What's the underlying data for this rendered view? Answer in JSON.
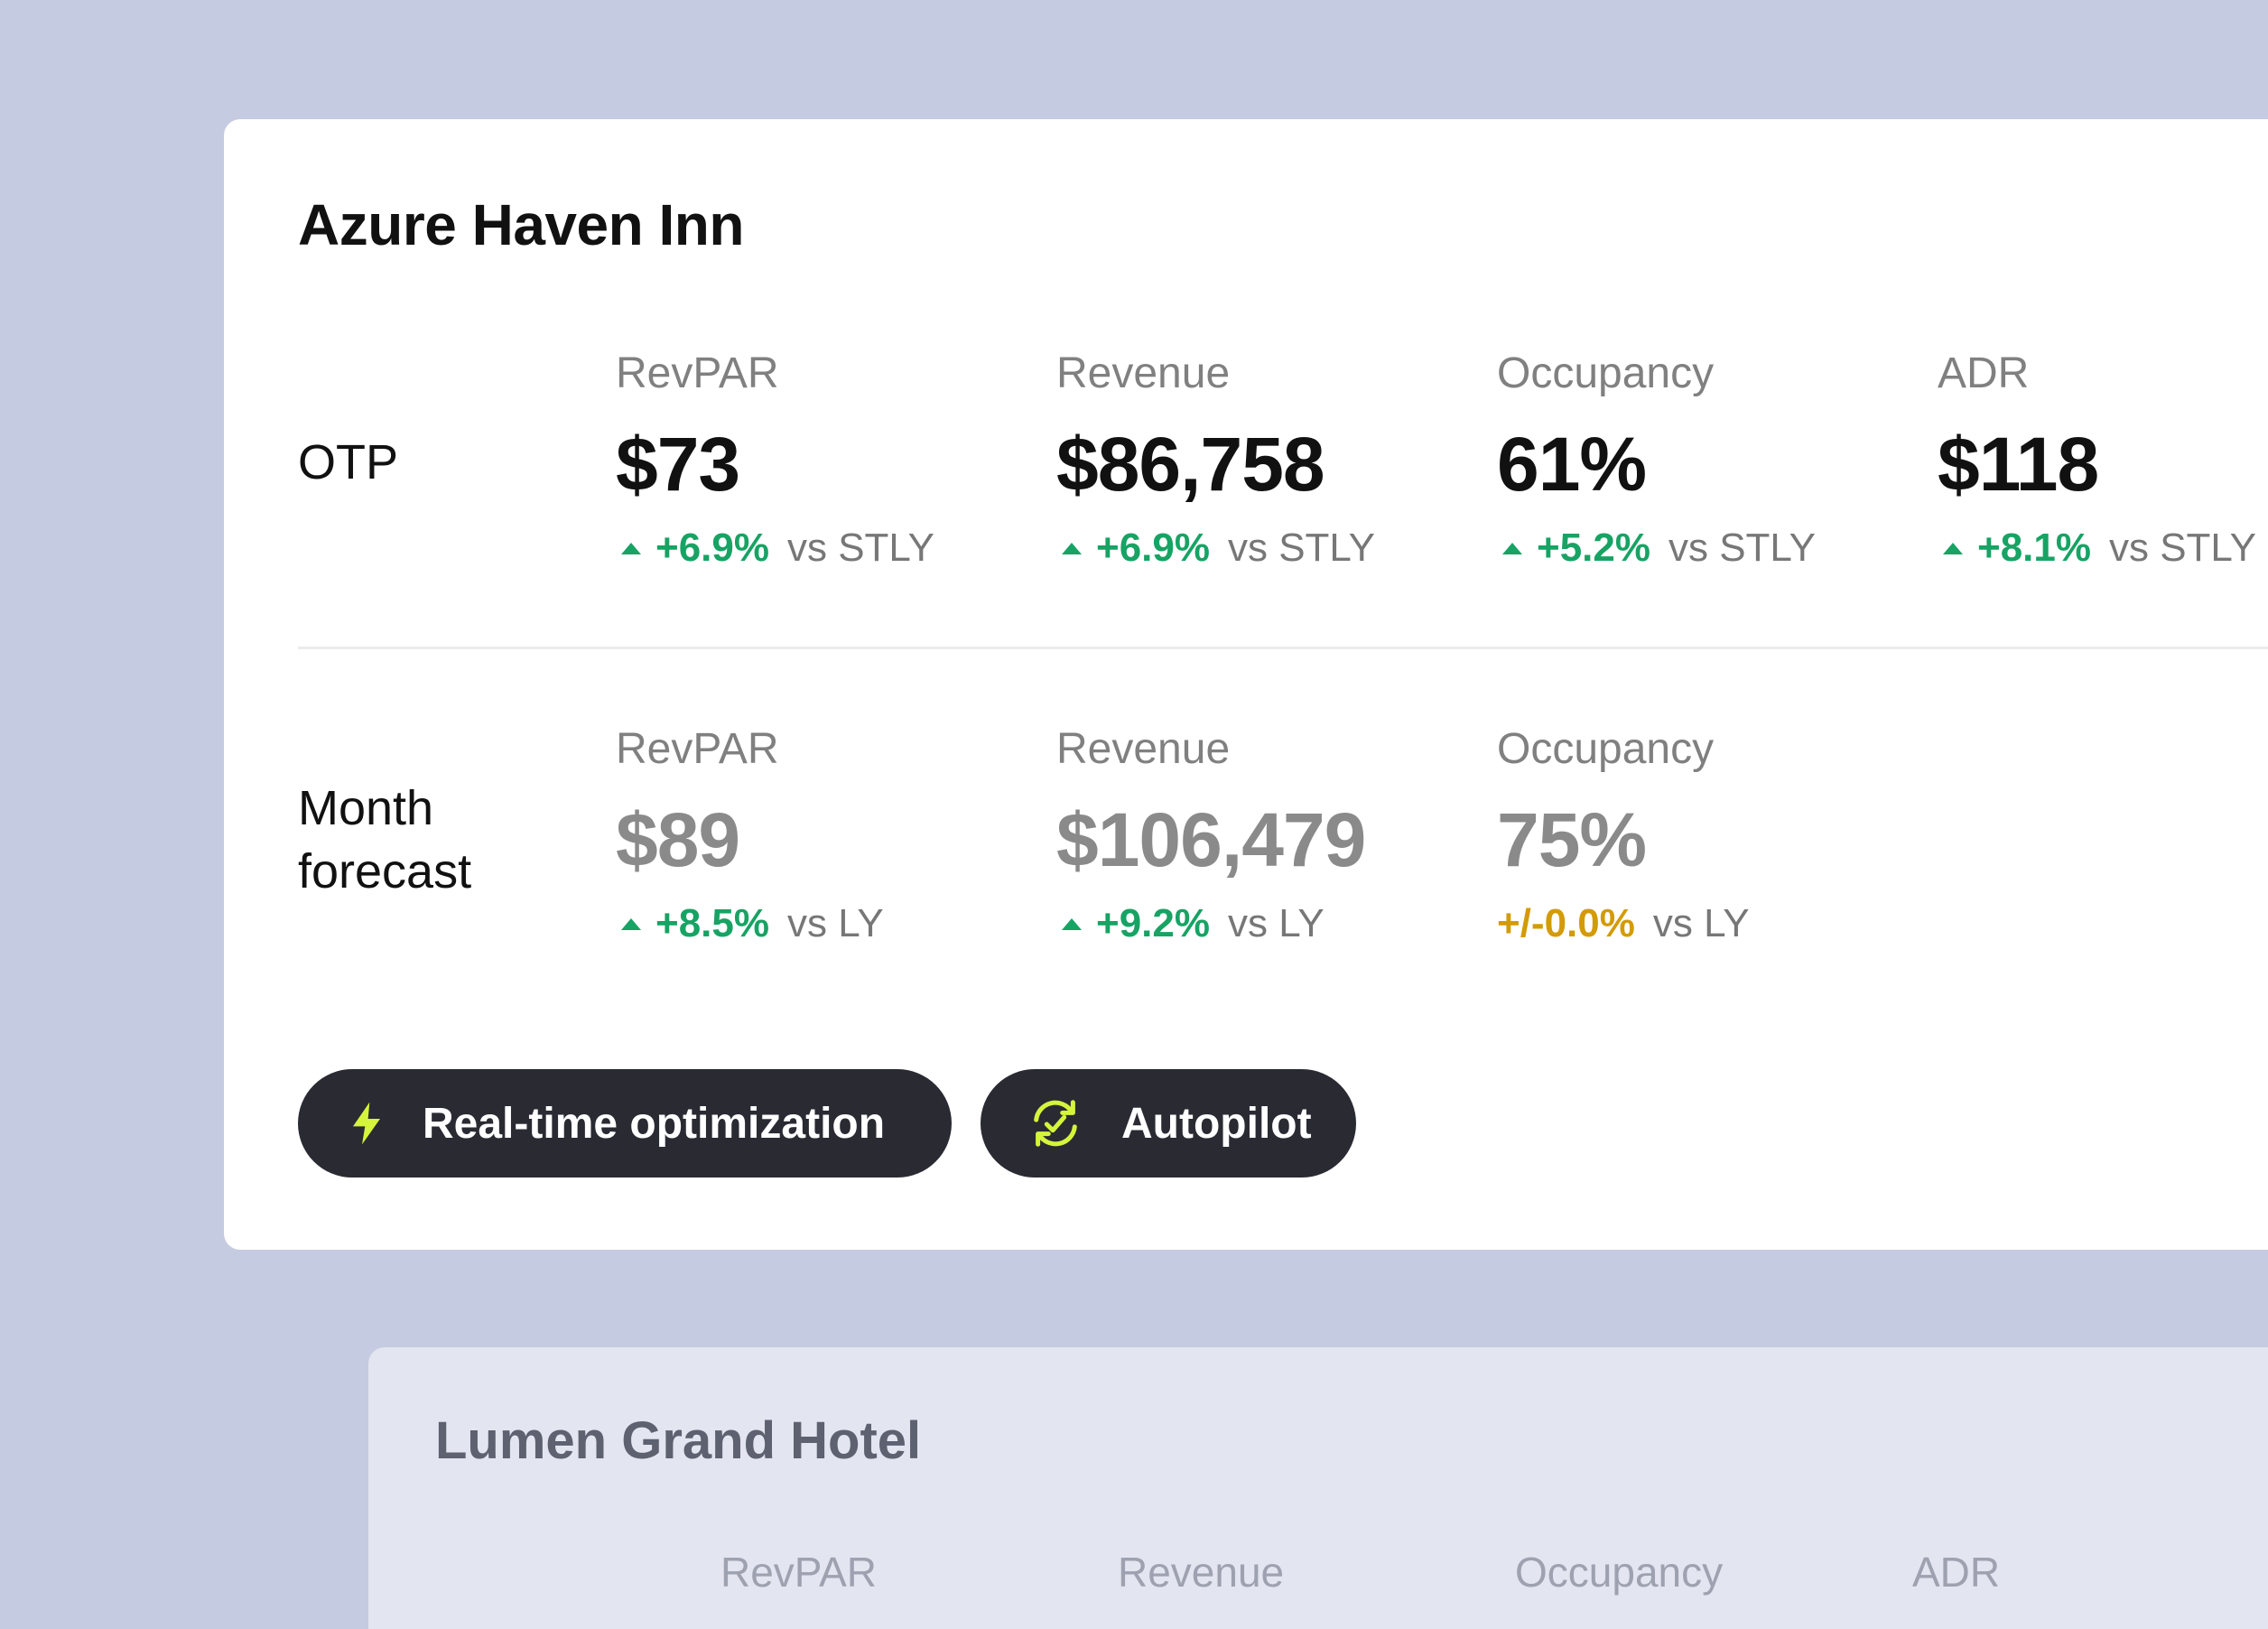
{
  "primary_card": {
    "hotel_name": "Azure Haven Inn",
    "otp": {
      "row_label": "OTP",
      "metrics": [
        {
          "label": "RevPAR",
          "value": "$73",
          "change": "+6.9%",
          "comparison": "vs STLY",
          "trend": "up"
        },
        {
          "label": "Revenue",
          "value": "$86,758",
          "change": "+6.9%",
          "comparison": "vs STLY",
          "trend": "up"
        },
        {
          "label": "Occupancy",
          "value": "61%",
          "change": "+5.2%",
          "comparison": "vs STLY",
          "trend": "up"
        },
        {
          "label": "ADR",
          "value": "$118",
          "change": "+8.1%",
          "comparison": "vs STLY",
          "trend": "up"
        }
      ]
    },
    "forecast": {
      "row_label": "Month forecast",
      "metrics": [
        {
          "label": "RevPAR",
          "value": "$89",
          "change": "+8.5%",
          "comparison": "vs LY",
          "trend": "up"
        },
        {
          "label": "Revenue",
          "value": "$106,479",
          "change": "+9.2%",
          "comparison": "vs LY",
          "trend": "up"
        },
        {
          "label": "Occupancy",
          "value": "75%",
          "change": "+/-0.0%",
          "comparison": "vs LY",
          "trend": "neutral"
        }
      ]
    },
    "buttons": {
      "realtime_label": "Real-time optimization",
      "autopilot_label": "Autopilot"
    }
  },
  "secondary_card": {
    "hotel_name": "Lumen Grand Hotel",
    "metric_labels": [
      "RevPAR",
      "Revenue",
      "Occupancy",
      "ADR"
    ]
  },
  "colors": {
    "background": "#c5cbe0",
    "positive": "#17a364",
    "neutral": "#d39b08",
    "button_bg": "#2a2a33",
    "icon_accent": "#d4f53c"
  },
  "icons": {
    "realtime": "lightning-bolt-icon",
    "autopilot": "refresh-check-icon"
  }
}
